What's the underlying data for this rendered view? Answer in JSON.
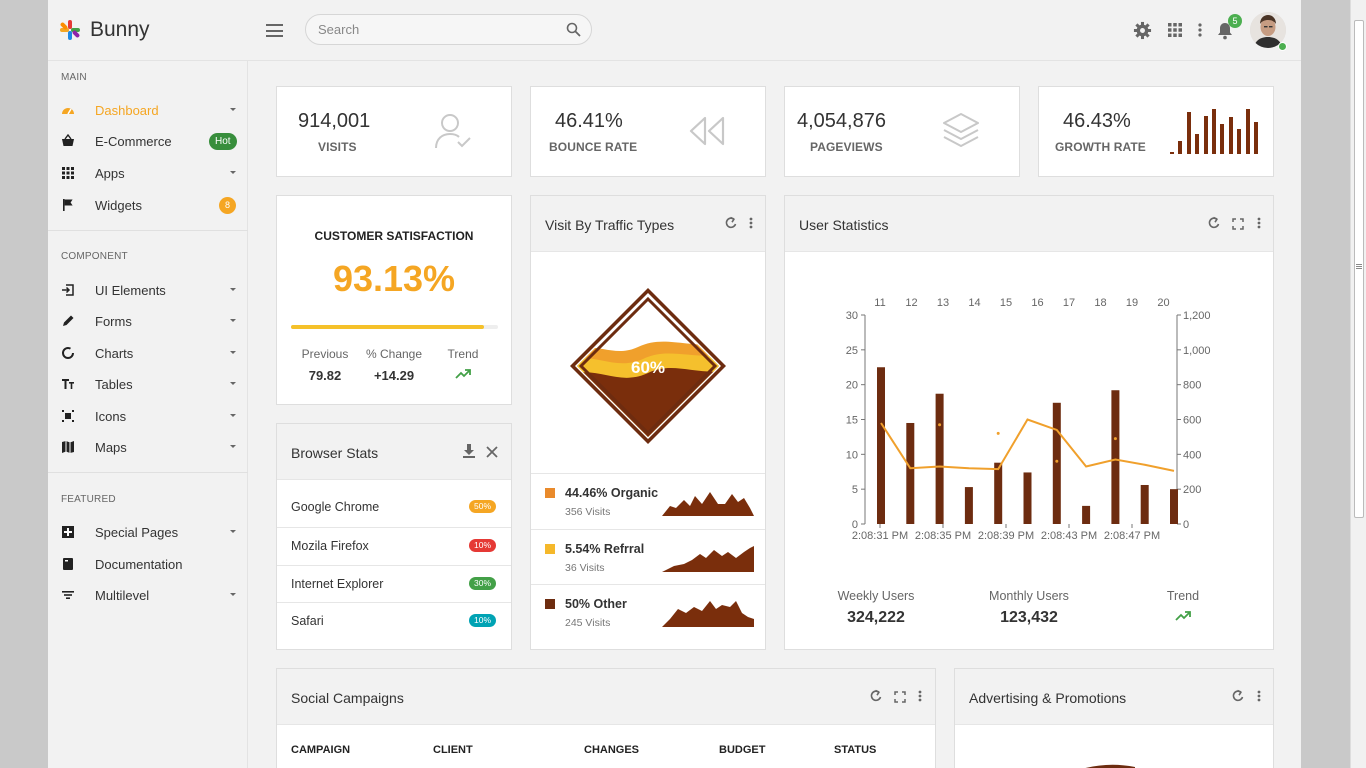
{
  "app": {
    "name": "Bunny"
  },
  "search": {
    "placeholder": "Search"
  },
  "header": {
    "notification_count": "5"
  },
  "sidebar": {
    "sections": [
      {
        "title": "MAIN"
      },
      {
        "title": "COMPONENT"
      },
      {
        "title": "FEATURED"
      }
    ],
    "items": [
      {
        "label": "Dashboard",
        "icon": "dashboard-icon"
      },
      {
        "label": "E-Commerce",
        "icon": "basket-icon",
        "badge": "Hot"
      },
      {
        "label": "Apps",
        "icon": "grid-icon"
      },
      {
        "label": "Widgets",
        "icon": "flag-icon",
        "badge": "8"
      },
      {
        "label": "UI Elements",
        "icon": "ui-elements-icon"
      },
      {
        "label": "Forms",
        "icon": "pencil-icon"
      },
      {
        "label": "Charts",
        "icon": "chart-ring-icon"
      },
      {
        "label": "Tables",
        "icon": "table-icon"
      },
      {
        "label": "Icons",
        "icon": "icons-icon"
      },
      {
        "label": "Maps",
        "icon": "map-icon"
      },
      {
        "label": "Special Pages",
        "icon": "special-pages-icon"
      },
      {
        "label": "Documentation",
        "icon": "book-icon"
      },
      {
        "label": "Multilevel",
        "icon": "filter-icon"
      }
    ]
  },
  "stats": [
    {
      "value": "914,001",
      "label": "VISITS",
      "icon": "user-check-icon"
    },
    {
      "value": "46.41%",
      "label": "BOUNCE RATE",
      "icon": "rewind-icon"
    },
    {
      "value": "4,054,876",
      "label": "PAGEVIEWS",
      "icon": "layers-icon"
    },
    {
      "value": "46.43%",
      "label": "GROWTH RATE",
      "icon": "sparkline-bars"
    }
  ],
  "growth_sparkline": [
    1,
    8,
    25,
    12,
    23,
    27,
    18,
    22,
    15,
    27,
    19
  ],
  "satisfaction": {
    "title": "CUSTOMER SATISFACTION",
    "value": "93.13%",
    "progress": 0.93,
    "previous_label": "Previous",
    "previous_value": "79.82",
    "change_label": "% Change",
    "change_value": "+14.29",
    "trend_label": "Trend"
  },
  "browser_stats": {
    "title": "Browser Stats",
    "rows": [
      {
        "name": "Google Chrome",
        "pct": "50%",
        "color": "#f5a623"
      },
      {
        "name": "Mozila Firefox",
        "pct": "10%",
        "color": "#e53935"
      },
      {
        "name": "Internet Explorer",
        "pct": "30%",
        "color": "#43a047"
      },
      {
        "name": "Safari",
        "pct": "10%",
        "color": "#00a3b4"
      }
    ]
  },
  "traffic": {
    "title": "Visit By Traffic Types",
    "gauge_label": "60%",
    "rows": [
      {
        "title": "44.46% Organic",
        "sub": "356 Visits",
        "color": "#e98a2b"
      },
      {
        "title": "5.54% Refrral",
        "sub": "36 Visits",
        "color": "#f5b82a"
      },
      {
        "title": "50% Other",
        "sub": "245 Visits",
        "color": "#6d2c10"
      }
    ]
  },
  "user_stats": {
    "title": "User Statistics",
    "weekly_label": "Weekly Users",
    "weekly_value": "324,222",
    "monthly_label": "Monthly Users",
    "monthly_value": "123,432",
    "trend_label": "Trend"
  },
  "chart_data": {
    "type": "bar",
    "top_ticks": [
      "11",
      "12",
      "13",
      "14",
      "15",
      "16",
      "17",
      "18",
      "19",
      "20"
    ],
    "x_ticks": [
      "2:08:31 PM",
      "2:08:35 PM",
      "2:08:39 PM",
      "2:08:43 PM",
      "2:08:47 PM"
    ],
    "y_left_ticks": [
      "0",
      "5",
      "10",
      "15",
      "20",
      "25",
      "30"
    ],
    "y_right_ticks": [
      "0",
      "200",
      "400",
      "600",
      "800",
      "1,000",
      "1,200"
    ],
    "ylim_left": [
      0,
      30
    ],
    "ylim_right": [
      0,
      1200
    ],
    "bars": [
      22.5,
      14.5,
      18.7,
      5.3,
      8.8,
      7.4,
      17.4,
      2.6,
      19.2,
      5.6,
      5
    ],
    "line": [
      580,
      320,
      330,
      320,
      315,
      600,
      540,
      330,
      370,
      340,
      305
    ],
    "dots": [
      570,
      520,
      360,
      490
    ]
  },
  "social": {
    "title": "Social Campaigns",
    "columns": [
      "CAMPAIGN",
      "CLIENT",
      "CHANGES",
      "BUDGET",
      "STATUS"
    ]
  },
  "ads": {
    "title": "Advertising & Promotions"
  },
  "colors": {
    "accent": "#f5a623",
    "brown": "#6d2c10",
    "green": "#43a047"
  }
}
